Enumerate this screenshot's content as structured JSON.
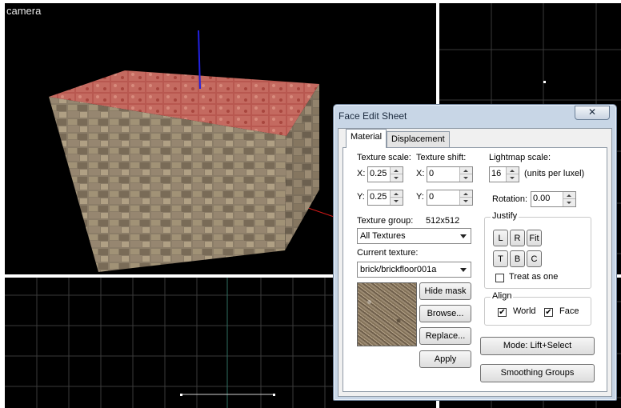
{
  "viewports": {
    "camera_label": "camera"
  },
  "dialog": {
    "title": "Face Edit Sheet",
    "close_glyph": "✕",
    "tabs": [
      {
        "label": "Material",
        "active": true
      },
      {
        "label": "Displacement",
        "active": false
      }
    ],
    "texture_scale": {
      "label": "Texture scale:",
      "x_label": "X:",
      "x_value": "0.25",
      "y_label": "Y:",
      "y_value": "0.25"
    },
    "texture_shift": {
      "label": "Texture shift:",
      "x_label": "X:",
      "x_value": "0",
      "y_label": "Y:",
      "y_value": "0"
    },
    "lightmap": {
      "label": "Lightmap scale:",
      "value": "16",
      "units": "(units per luxel)"
    },
    "rotation": {
      "label": "Rotation:",
      "value": "0.00"
    },
    "texture_group": {
      "label": "Texture group:",
      "size": "512x512",
      "selected": "All Textures"
    },
    "current_texture": {
      "label": "Current texture:",
      "selected": "brick/brickfloor001a"
    },
    "buttons": {
      "hide_mask": "Hide mask",
      "browse": "Browse...",
      "replace": "Replace...",
      "apply": "Apply",
      "mode": "Mode: Lift+Select",
      "smoothing": "Smoothing Groups"
    },
    "justify": {
      "title": "Justify",
      "row1": [
        "L",
        "R",
        "Fit"
      ],
      "row2": [
        "T",
        "B",
        "C"
      ],
      "treat_as_one": {
        "label": "Treat as one",
        "checked": false
      }
    },
    "align": {
      "title": "Align",
      "world": {
        "label": "World",
        "checked": true
      },
      "face": {
        "label": "Face",
        "checked": true
      }
    }
  }
}
